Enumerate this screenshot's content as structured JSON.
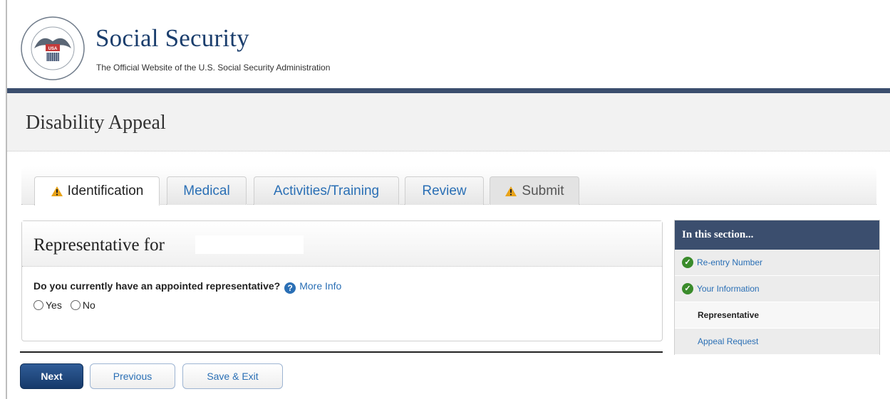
{
  "header": {
    "title": "Social Security",
    "subtitle": "The Official Website of the U.S. Social Security Administration",
    "seal_text": "SOCIAL SECURITY ADMINISTRATION USA"
  },
  "page": {
    "title": "Disability Appeal"
  },
  "tabs": [
    {
      "label": "Identification",
      "state": "active",
      "icon": "warning-icon"
    },
    {
      "label": "Medical",
      "state": "normal"
    },
    {
      "label": "Activities/Training",
      "state": "normal"
    },
    {
      "label": "Review",
      "state": "normal"
    },
    {
      "label": "Submit",
      "state": "disabled",
      "icon": "warning-icon"
    }
  ],
  "main": {
    "heading": "Representative for",
    "question": "Do you currently have an appointed representative?",
    "more_info_label": "More Info",
    "options": [
      "Yes",
      "No"
    ]
  },
  "buttons": {
    "next": "Next",
    "previous": "Previous",
    "save_exit": "Save & Exit"
  },
  "sidebar": {
    "heading": "In this section...",
    "items": [
      {
        "label": "Re-entry Number",
        "state": "completed"
      },
      {
        "label": "Your Information",
        "state": "completed"
      },
      {
        "label": "Representative",
        "state": "current"
      },
      {
        "label": "Appeal Request",
        "state": "pending"
      }
    ]
  },
  "colors": {
    "brand_navy": "#1b3e6d",
    "link_blue": "#2a6fb5",
    "header_bar": "#3b4e6e",
    "check_green": "#3a8b2b",
    "warning_orange": "#e8a319"
  }
}
